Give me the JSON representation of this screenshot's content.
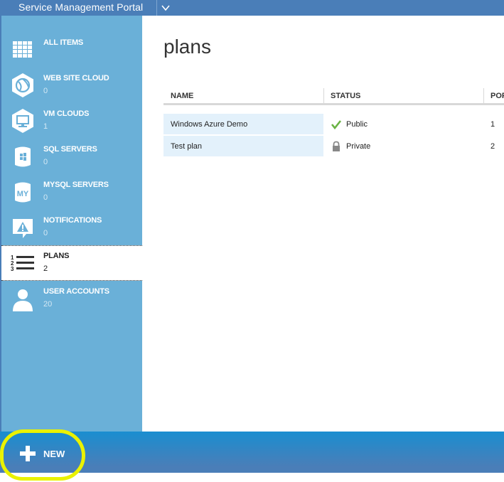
{
  "header": {
    "title": "Service Management Portal"
  },
  "sidebar": {
    "items": [
      {
        "label": "ALL ITEMS",
        "count": "",
        "icon": "grid-icon"
      },
      {
        "label": "WEB SITE CLOUD",
        "count": "0",
        "icon": "web-site-cloud-icon"
      },
      {
        "label": "VM CLOUDS",
        "count": "1",
        "icon": "vm-clouds-icon"
      },
      {
        "label": "SQL SERVERS",
        "count": "0",
        "icon": "sql-server-icon"
      },
      {
        "label": "MYSQL SERVERS",
        "count": "0",
        "icon": "mysql-server-icon",
        "icon_text": "MY"
      },
      {
        "label": "NOTIFICATIONS",
        "count": "0",
        "icon": "notification-icon"
      },
      {
        "label": "PLANS",
        "count": "2",
        "icon": "plans-list-icon",
        "active": true
      },
      {
        "label": "USER ACCOUNTS",
        "count": "20",
        "icon": "user-icon"
      }
    ]
  },
  "main": {
    "title": "plans",
    "columns": [
      "NAME",
      "STATUS",
      "POF"
    ],
    "rows": [
      {
        "name": "Windows Azure Demo",
        "status": "Public",
        "status_icon": "checkmark-icon",
        "num": "1"
      },
      {
        "name": "Test plan",
        "status": "Private",
        "status_icon": "lock-icon",
        "num": "2"
      }
    ]
  },
  "bottom": {
    "new_label": "NEW"
  },
  "colors": {
    "header": "#4a7eb8",
    "sidebar": "#6ab0d8",
    "row_highlight": "#e3f1fb",
    "bottom_bar": "#1a8ed0",
    "annotation": "#eaf200"
  }
}
